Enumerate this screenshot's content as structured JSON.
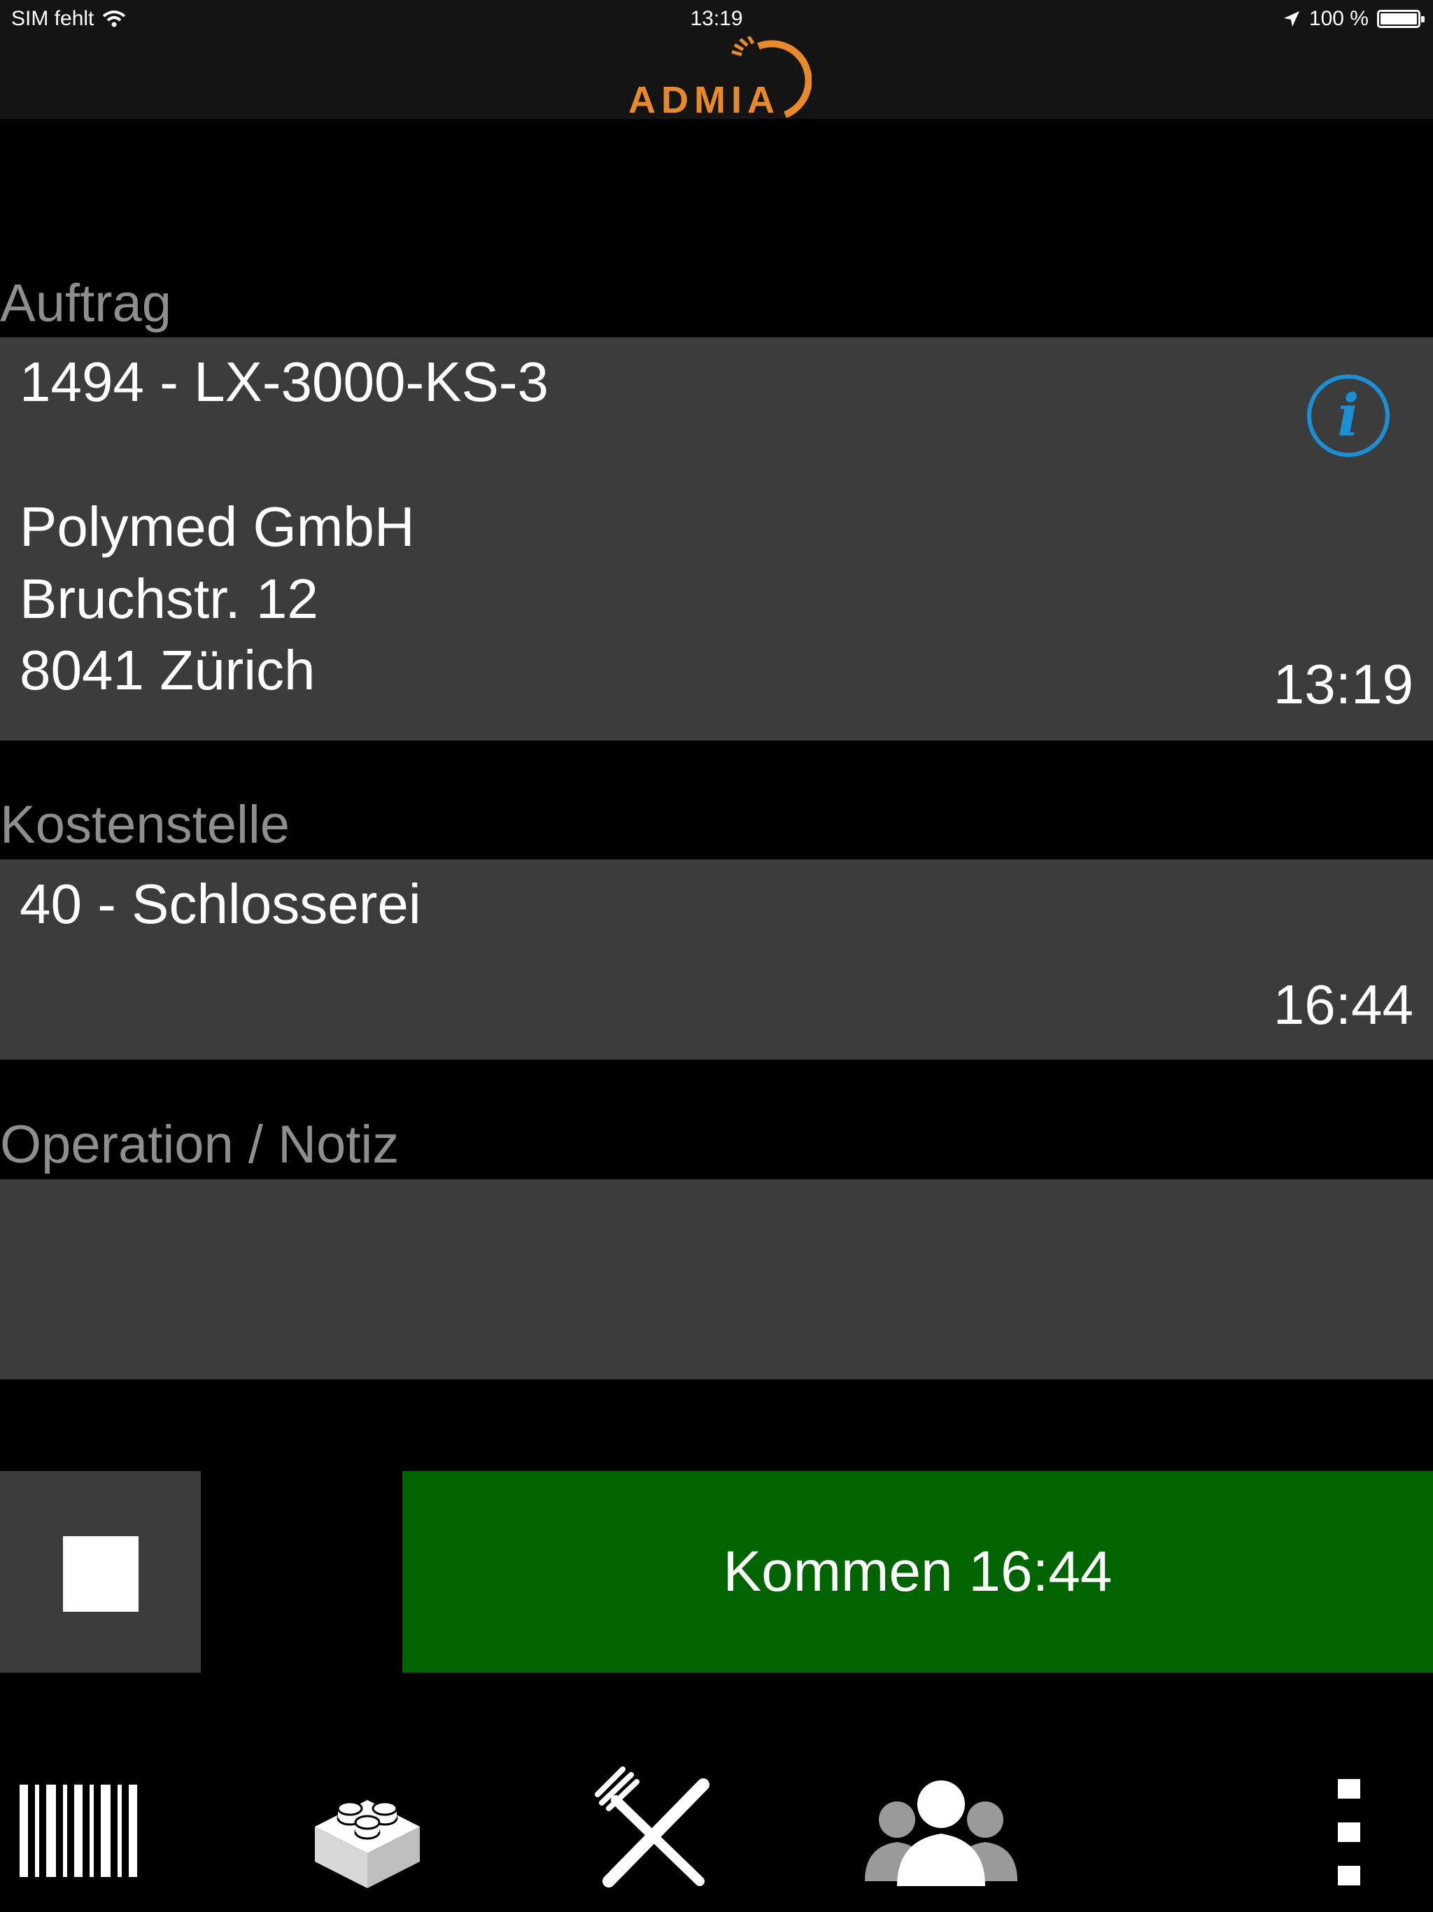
{
  "status_bar": {
    "carrier": "SIM fehlt",
    "time": "13:19",
    "battery_text": "100 %"
  },
  "header": {
    "logo_text": "ADMIA",
    "logo_color": "#e8892a"
  },
  "auftrag": {
    "label": "Auftrag",
    "order": "1494 - LX-3000-KS-3",
    "company": "Polymed GmbH",
    "street": "Bruchstr. 12",
    "city": "8041 Zürich",
    "time": "13:19",
    "info_icon": "info-icon"
  },
  "kostenstelle": {
    "label": "Kostenstelle",
    "value": "40 - Schlosserei",
    "time": "16:44"
  },
  "operation": {
    "label": "Operation / Notiz",
    "value": ""
  },
  "actions": {
    "stop_icon": "stop-icon",
    "kommen_label": "Kommen 16:44",
    "kommen_color": "#006400"
  },
  "tabbar": {
    "items": [
      "barcode-icon",
      "lego-brick-icon",
      "fork-knife-icon",
      "group-icon",
      "more-vertical-icon"
    ]
  }
}
